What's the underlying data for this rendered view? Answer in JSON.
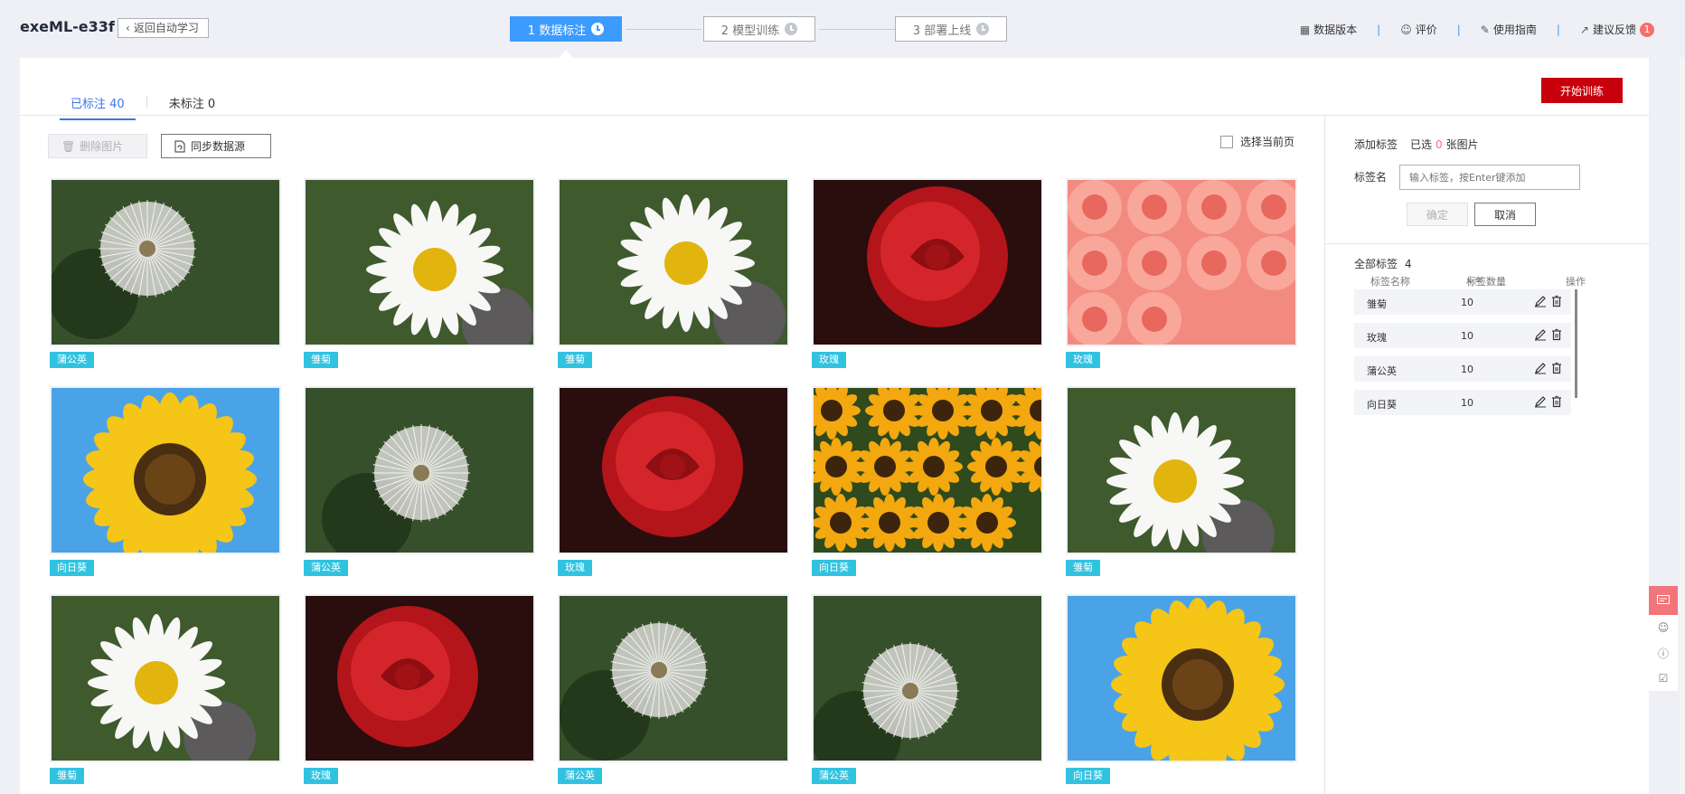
{
  "app": {
    "title": "exeML-e33f",
    "back_label": "返回自动学习"
  },
  "steps": [
    {
      "label": "1 数据标注",
      "state": "active"
    },
    {
      "label": "2 模型训练",
      "state": "idle"
    },
    {
      "label": "3 部署上线",
      "state": "idle"
    }
  ],
  "top_links": {
    "data_version": "数据版本",
    "evaluate": "评价",
    "guide": "使用指南",
    "feedback": "建议反馈",
    "feedback_badge": "1"
  },
  "tabs": {
    "labeled": "已标注 40",
    "unlabeled": "未标注 0"
  },
  "toolbar": {
    "start_training": "开始训练",
    "delete_images": "删除图片",
    "sync_source": "同步数据源",
    "select_page": "选择当前页"
  },
  "images": [
    {
      "label": "蒲公英",
      "kind": "dandelion"
    },
    {
      "label": "雏菊",
      "kind": "daisy"
    },
    {
      "label": "雏菊",
      "kind": "daisy"
    },
    {
      "label": "玫瑰",
      "kind": "rose"
    },
    {
      "label": "玫瑰",
      "kind": "pinkroses"
    },
    {
      "label": "向日葵",
      "kind": "sunflower"
    },
    {
      "label": "蒲公英",
      "kind": "dandelion"
    },
    {
      "label": "玫瑰",
      "kind": "rose"
    },
    {
      "label": "向日葵",
      "kind": "sunflowers"
    },
    {
      "label": "雏菊",
      "kind": "daisy"
    },
    {
      "label": "雏菊",
      "kind": "daisy"
    },
    {
      "label": "玫瑰",
      "kind": "rose"
    },
    {
      "label": "蒲公英",
      "kind": "dandelion"
    },
    {
      "label": "蒲公英",
      "kind": "dandelion"
    },
    {
      "label": "向日葵",
      "kind": "sunflower"
    }
  ],
  "add_label": {
    "title": "添加标签",
    "selected_prefix": "已选",
    "selected_count": "0",
    "selected_suffix": "张图片",
    "name_label": "标签名",
    "input_placeholder": "输入标签，按Enter键添加",
    "confirm": "确定",
    "cancel": "取消"
  },
  "all_labels": {
    "title": "全部标签",
    "count": "4",
    "col_name": "标签名称",
    "col_count": "标签数量",
    "col_ops": "操作",
    "rows": [
      {
        "name": "雏菊",
        "count": "10"
      },
      {
        "name": "玫瑰",
        "count": "10"
      },
      {
        "name": "蒲公英",
        "count": "10"
      },
      {
        "name": "向日葵",
        "count": "10"
      }
    ]
  },
  "colors": {
    "accent": "#3c9bff",
    "primary_red": "#c7000b",
    "tag": "#31c2e0",
    "tab_active": "#3c77e8"
  }
}
